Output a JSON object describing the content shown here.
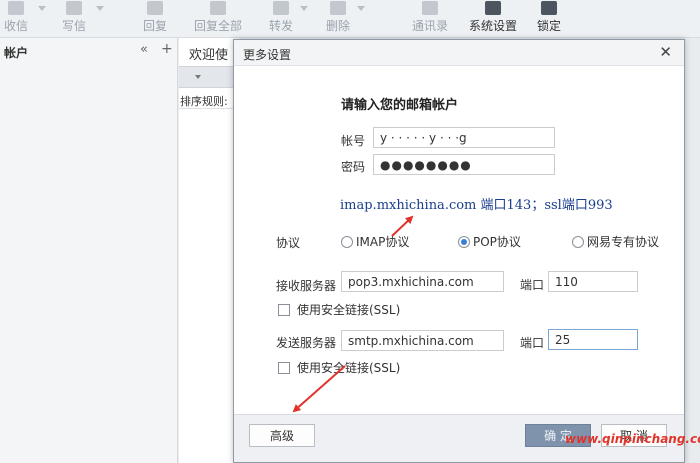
{
  "toolbar": {
    "items": [
      {
        "label": "收信",
        "icon": "receive-mail-icon"
      },
      {
        "label": "写信",
        "icon": "compose-icon"
      },
      {
        "label": "回复",
        "icon": "reply-icon"
      },
      {
        "label": "回复全部",
        "icon": "reply-all-icon"
      },
      {
        "label": "转发",
        "icon": "forward-icon"
      },
      {
        "label": "删除",
        "icon": "delete-icon"
      },
      {
        "label": "通讯录",
        "icon": "contacts-icon"
      },
      {
        "label": "系统设置",
        "icon": "gear-icon"
      },
      {
        "label": "锁定",
        "icon": "lock-icon"
      }
    ]
  },
  "sidebar": {
    "title": "帐户",
    "collapse": "«",
    "add": "+"
  },
  "listpane": {
    "tab": "欢迎使",
    "sort": "排序规则:"
  },
  "dialog": {
    "title": "更多设置",
    "close": "✕",
    "prompt": "请输入您的邮箱帐户",
    "account_label": "帐号",
    "account_value": "y ·  · · · · y · · ·g",
    "password_label": "密码",
    "password_value": "●●●●●●●●",
    "hint": "imap.mxhichina.com 端口143；ssl端口993",
    "protocol_label": "协议",
    "protocols": [
      {
        "label": "IMAP协议",
        "selected": false
      },
      {
        "label": "POP协议",
        "selected": true
      },
      {
        "label": "网易专有协议",
        "selected": false
      }
    ],
    "incoming_label": "接收服务器",
    "incoming_value": "pop3.mxhichina.com",
    "incoming_port_label": "端口",
    "incoming_port": "110",
    "incoming_ssl_label": "使用安全链接(SSL)",
    "incoming_ssl_checked": false,
    "outgoing_label": "发送服务器",
    "outgoing_value": "smtp.mxhichina.com",
    "outgoing_port_label": "端口",
    "outgoing_port": "25",
    "outgoing_ssl_label": "使用安全链接(SSL)",
    "outgoing_ssl_checked": false,
    "advanced_button": "高级",
    "ok_button": "确 定",
    "cancel_button": "取 消"
  },
  "watermark": "www.qinpinchang.com",
  "colors": {
    "annotation_arrow": "#e0342b",
    "hint_text": "#1a3e8c",
    "radio_selected": "#3b7dd8"
  }
}
